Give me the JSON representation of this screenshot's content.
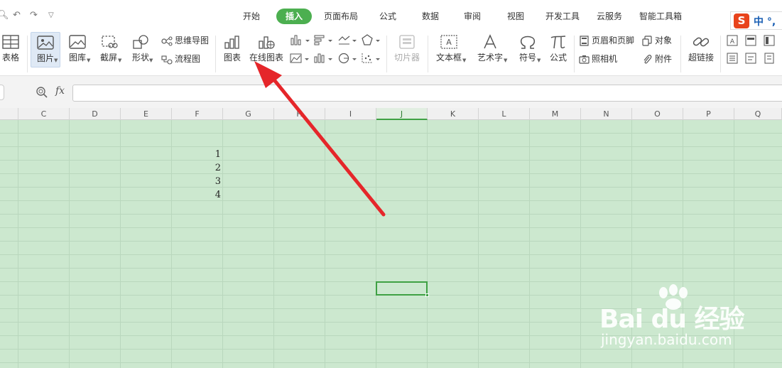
{
  "menu": {
    "tabs": [
      "开始",
      "插入",
      "页面布局",
      "公式",
      "数据",
      "审阅",
      "视图",
      "开发工具",
      "云服务",
      "智能工具箱"
    ],
    "active_tab": "插入"
  },
  "ime": {
    "logo": "S",
    "text": "中 °,"
  },
  "ribbon": {
    "table": "表格",
    "picture": "图片",
    "gallery": "图库",
    "screenshot": "截屏",
    "shapes": "形状",
    "mindmap": "思维导图",
    "flowchart": "流程图",
    "chart": "图表",
    "online_chart": "在线图表",
    "slicer": "切片器",
    "textbox": "文本框",
    "wordart": "艺术字",
    "symbol": "符号",
    "formula": "公式",
    "header_footer": "页眉和页脚",
    "object": "对象",
    "camera": "照相机",
    "attachment": "附件",
    "hyperlink": "超链接"
  },
  "formula_bar": {
    "fx": "fx",
    "value": ""
  },
  "columns": [
    "C",
    "D",
    "E",
    "F",
    "G",
    "H",
    "I",
    "J",
    "K",
    "L",
    "M",
    "N",
    "O",
    "P",
    "Q"
  ],
  "active_column": "J",
  "cells": [
    "1",
    "2",
    "3",
    "4"
  ],
  "watermark": {
    "brand": "Bai du 经验",
    "url": "jingyan.baidu.com"
  },
  "colors": {
    "accent": "#4caf50",
    "sheet_bg": "#cce8cf",
    "arrow": "#e5262a"
  }
}
